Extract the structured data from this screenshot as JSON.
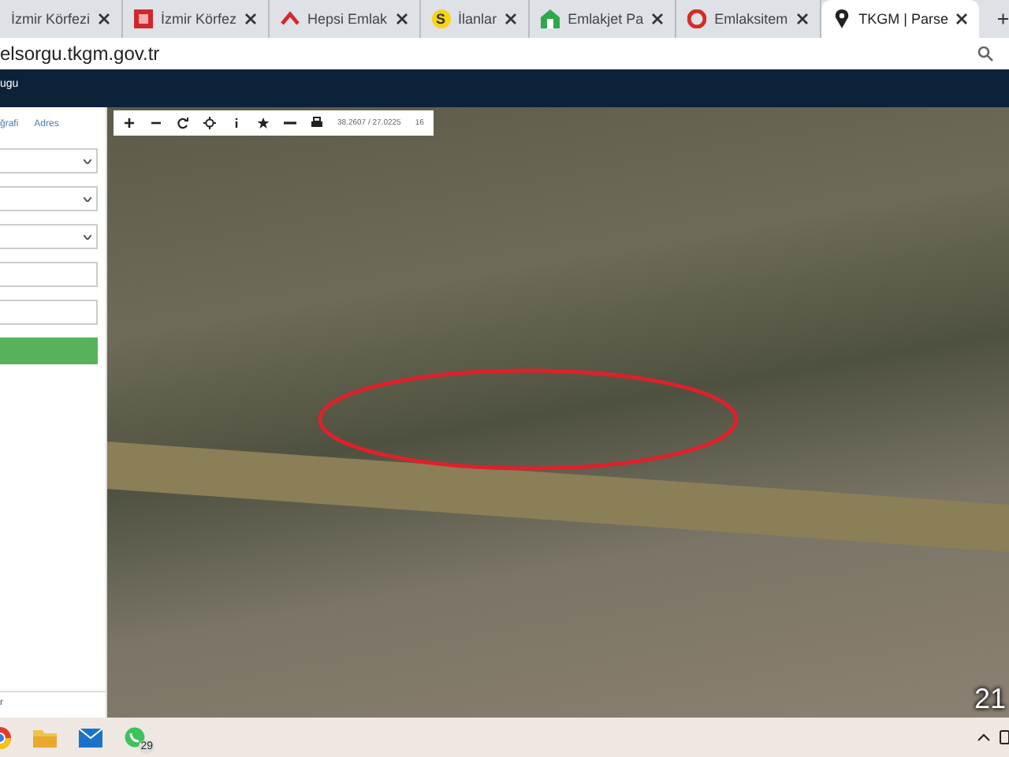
{
  "browser": {
    "tabs": [
      {
        "kind": "izmir",
        "title": "İzmir Körfezi",
        "selected": false
      },
      {
        "kind": "izmir",
        "title": "İzmir Körfez",
        "selected": false
      },
      {
        "kind": "hepsi",
        "title": "Hepsi Emlak",
        "selected": false
      },
      {
        "kind": "letter",
        "icon_text": "S",
        "title": "İlanlar",
        "selected": false
      },
      {
        "kind": "house",
        "title": "Emlakjet Pa",
        "selected": false
      },
      {
        "kind": "ring",
        "title": "Emlaksitem",
        "selected": false
      },
      {
        "kind": "pin",
        "title": "TKGM | Parse",
        "selected": true
      }
    ],
    "address": "elsorgu.tkgm.gov.tr"
  },
  "site": {
    "header": "ugu",
    "panel": {
      "tabs": [
        {
          "label": "ğrafi",
          "selected": false
        },
        {
          "label": "Adres",
          "selected": false
        }
      ],
      "fields": [
        {
          "kind": "select"
        },
        {
          "kind": "select"
        },
        {
          "kind": "select"
        },
        {
          "kind": "input"
        },
        {
          "kind": "input"
        },
        {
          "kind": "button"
        }
      ],
      "footer": "r"
    },
    "map": {
      "coordinates": "38.2607 / 27.0225",
      "zoom": "16"
    }
  },
  "taskbar": {
    "apps": [
      {
        "kind": "browser"
      },
      {
        "kind": "folder"
      },
      {
        "kind": "mail"
      },
      {
        "kind": "chat",
        "badge": "29"
      }
    ],
    "clock": "21"
  }
}
